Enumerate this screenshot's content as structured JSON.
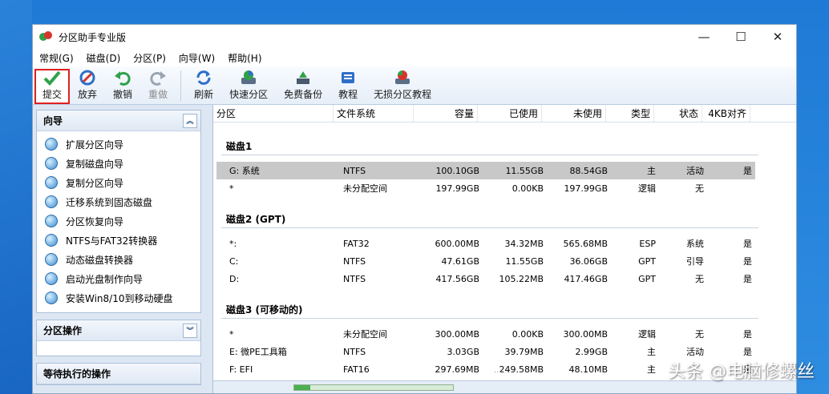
{
  "window": {
    "title": "分区助手专业版",
    "controls": {
      "minimize": "—",
      "maximize": "☐",
      "close": "✕"
    }
  },
  "menu": [
    "常规(G)",
    "磁盘(D)",
    "分区(P)",
    "向导(W)",
    "帮助(H)"
  ],
  "toolbar": [
    {
      "label": "提交",
      "icon": "check-icon",
      "color": "#2ea14a"
    },
    {
      "label": "放弃",
      "icon": "cancel-icon",
      "color": "#2e6fc9"
    },
    {
      "label": "撤销",
      "icon": "undo-icon",
      "color": "#2ea14a"
    },
    {
      "label": "重做",
      "icon": "redo-icon",
      "color": "#9aa5b1"
    },
    {
      "label": "刷新",
      "icon": "refresh-icon",
      "color": "#2e6fc9"
    },
    {
      "label": "快速分区",
      "icon": "quick-partition-icon",
      "color": "#2e6fc9"
    },
    {
      "label": "免费备份",
      "icon": "backup-icon",
      "color": "#2ea14a"
    },
    {
      "label": "教程",
      "icon": "tutorial-icon",
      "color": "#2e6fc9"
    },
    {
      "label": "无损分区教程",
      "icon": "lossless-tutorial-icon",
      "color": "#d8342b"
    }
  ],
  "left": {
    "wizard_title": "向导",
    "wizard_items": [
      "扩展分区向导",
      "复制磁盘向导",
      "复制分区向导",
      "迁移系统到固态磁盘",
      "分区恢复向导",
      "NTFS与FAT32转换器",
      "动态磁盘转换器",
      "启动光盘制作向导",
      "安装Win8/10到移动硬盘"
    ],
    "partition_ops_title": "分区操作",
    "pending_ops_title": "等待执行的操作"
  },
  "columns": [
    "分区",
    "文件系统",
    "容量",
    "已使用",
    "未使用",
    "类型",
    "状态",
    "4KB对齐"
  ],
  "disks": [
    {
      "name": "磁盘1",
      "rows": [
        {
          "cells": [
            "G: 系统",
            "NTFS",
            "100.10GB",
            "11.55GB",
            "88.54GB",
            "主",
            "活动",
            "是"
          ],
          "selected": true
        },
        {
          "cells": [
            "*",
            "未分配空间",
            "197.99GB",
            "0.00KB",
            "197.99GB",
            "逻辑",
            "无",
            ""
          ],
          "selected": false
        }
      ]
    },
    {
      "name": "磁盘2 (GPT)",
      "rows": [
        {
          "cells": [
            "*:",
            "FAT32",
            "600.00MB",
            "34.32MB",
            "565.68MB",
            "ESP",
            "系统",
            "是"
          ],
          "selected": false
        },
        {
          "cells": [
            "C:",
            "NTFS",
            "47.61GB",
            "11.55GB",
            "36.06GB",
            "GPT",
            "引导",
            "是"
          ],
          "selected": false
        },
        {
          "cells": [
            "D:",
            "NTFS",
            "417.56GB",
            "105.22MB",
            "417.46GB",
            "GPT",
            "无",
            "是"
          ],
          "selected": false
        }
      ]
    },
    {
      "name": "磁盘3 (可移动的)",
      "rows": [
        {
          "cells": [
            "*",
            "未分配空间",
            "300.00MB",
            "0.00KB",
            "300.00MB",
            "逻辑",
            "无",
            "是"
          ],
          "selected": false
        },
        {
          "cells": [
            "E: 微PE工具箱",
            "NTFS",
            "3.03GB",
            "39.79MB",
            "2.99GB",
            "主",
            "活动",
            "是"
          ],
          "selected": false
        },
        {
          "cells": [
            "F: EFI",
            "FAT16",
            "297.69MB",
            "249.58MB",
            "48.10MB",
            "主",
            "",
            "是"
          ],
          "selected": false
        }
      ]
    }
  ],
  "progress": 0.1,
  "watermark": "头条 @电脑修螺丝"
}
